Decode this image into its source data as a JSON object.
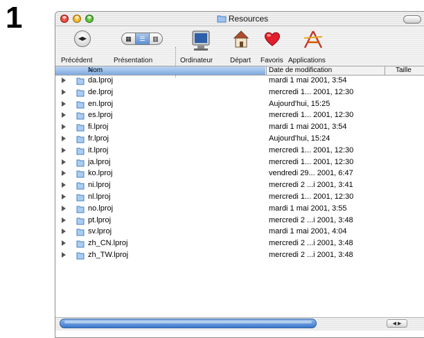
{
  "step_number": "1",
  "window": {
    "title": "Resources"
  },
  "toolbar": {
    "back_label": "Précédent",
    "view_label": "Présentation",
    "computer_label": "Ordinateur",
    "home_label": "Départ",
    "favorites_label": "Favoris",
    "applications_label": "Applications"
  },
  "columns": {
    "name": "Nom",
    "date": "Date de modification",
    "size": "Taille"
  },
  "files": [
    {
      "name": "da.lproj",
      "date": "mardi 1 mai 2001, 3:54"
    },
    {
      "name": "de.lproj",
      "date": "mercredi 1... 2001, 12:30"
    },
    {
      "name": "en.lproj",
      "date": "Aujourd'hui, 15:25"
    },
    {
      "name": "es.lproj",
      "date": "mercredi 1... 2001, 12:30"
    },
    {
      "name": "fi.lproj",
      "date": "mardi 1 mai 2001, 3:54"
    },
    {
      "name": "fr.lproj",
      "date": "Aujourd'hui, 15:24"
    },
    {
      "name": "it.lproj",
      "date": "mercredi 1... 2001, 12:30"
    },
    {
      "name": "ja.lproj",
      "date": "mercredi 1... 2001, 12:30"
    },
    {
      "name": "ko.lproj",
      "date": "vendredi 29... 2001, 6:47"
    },
    {
      "name": "ni.lproj",
      "date": "mercredi 2 ...i 2001, 3:41"
    },
    {
      "name": "nl.lproj",
      "date": "mercredi 1... 2001, 12:30"
    },
    {
      "name": "no.lproj",
      "date": "mardi 1 mai 2001, 3:55"
    },
    {
      "name": "pt.lproj",
      "date": "mercredi 2 ...i 2001, 3:48"
    },
    {
      "name": "sv.lproj",
      "date": "mardi 1 mai 2001, 4:04"
    },
    {
      "name": "zh_CN.lproj",
      "date": "mercredi 2 ...i 2001, 3:48"
    },
    {
      "name": "zh_TW.lproj",
      "date": "mercredi 2 ...i 2001, 3:48"
    }
  ],
  "colors": {
    "selection_blue": "#7fa9de",
    "scrollbar_blue": "#3b78cc"
  }
}
